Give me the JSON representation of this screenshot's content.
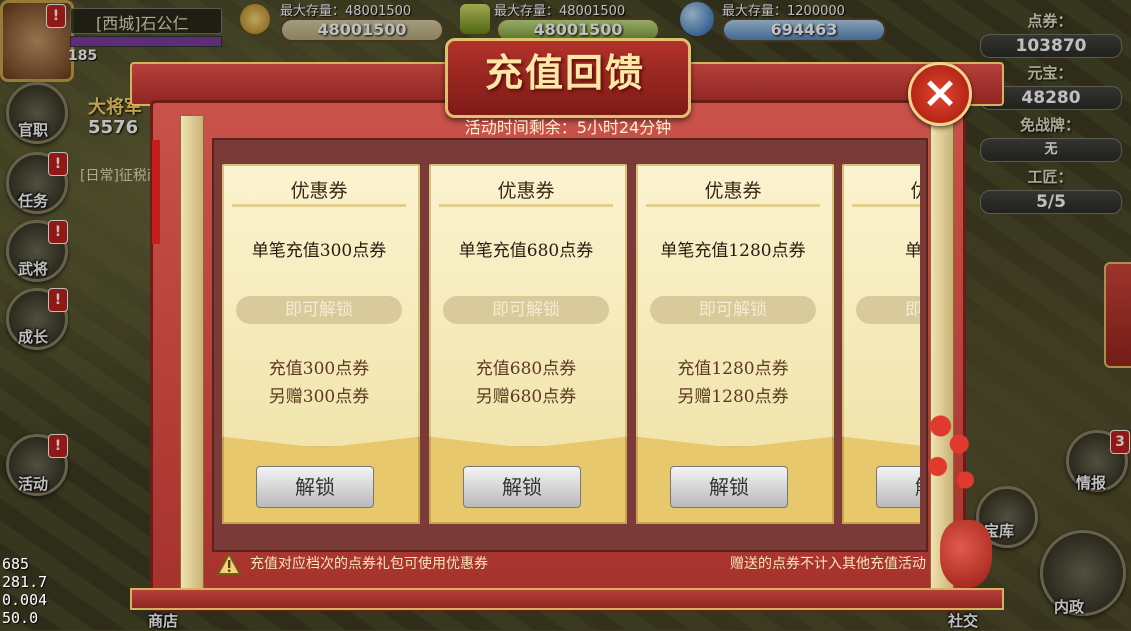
{
  "player": {
    "name": "[西城]石公仁",
    "level": "185",
    "rank_title": "大将军",
    "power": "5576",
    "badge": "!",
    "quest_text": "[日常]征税两"
  },
  "resources": [
    {
      "label": "最大存量：48001500",
      "value": "48001500",
      "icon": "coin-icon"
    },
    {
      "label": "最大存量：48001500",
      "value": "48001500",
      "icon": "grain-icon"
    },
    {
      "label": "最大存量：1200000",
      "value": "694463",
      "icon": "orb-icon"
    }
  ],
  "right_stats": [
    {
      "label": "点券：",
      "value": "103870"
    },
    {
      "label": "元宝：",
      "value": "48280"
    },
    {
      "label": "免战牌：",
      "value": "无"
    },
    {
      "label": "工匠：",
      "value": "5/5"
    }
  ],
  "left_menu": [
    {
      "label": "官职",
      "badge": ""
    },
    {
      "label": "任务",
      "badge": "!"
    },
    {
      "label": "武将",
      "badge": "!"
    },
    {
      "label": "成长",
      "badge": "!"
    },
    {
      "label": "活动",
      "badge": "!"
    }
  ],
  "right_menu": [
    {
      "label": "情报",
      "badge": "3"
    },
    {
      "label": "宝库",
      "badge": ""
    },
    {
      "label": "内政",
      "badge": ""
    }
  ],
  "bottom_menu": [
    {
      "label": "商店"
    },
    {
      "label": "社交"
    }
  ],
  "dialog": {
    "title": "充值回馈",
    "time_remaining": "活动时间剩余：5小时24分钟",
    "close_icon": "close-icon",
    "cards": [
      {
        "title": "优惠券",
        "condition": "单笔充值300点券",
        "unlock_hint": "即可解锁",
        "line1": "充值300点券",
        "line2": "另赠300点券",
        "button": "解锁"
      },
      {
        "title": "优惠券",
        "condition": "单笔充值680点券",
        "unlock_hint": "即可解锁",
        "line1": "充值680点券",
        "line2": "另赠680点券",
        "button": "解锁"
      },
      {
        "title": "优惠券",
        "condition": "单笔充值1280点券",
        "unlock_hint": "即可解锁",
        "line1": "充值1280点券",
        "line2": "另赠1280点券",
        "button": "解锁"
      },
      {
        "title": "优惠券",
        "condition": "单笔充值",
        "unlock_hint": "即可解锁",
        "line1": "充值",
        "line2": "另赠",
        "button": "解锁"
      }
    ],
    "note_left": "充值对应档次的点券礼包可使用优惠券",
    "note_right": "赠送的点券不计入其他充值活动"
  },
  "debug": [
    "685",
    "281.7",
    "0.004",
    "50.0"
  ],
  "colors": {
    "dialog_red": "#a6312c",
    "gold": "#e0bf6e",
    "card_cream": "#fbf3cf",
    "close_red": "#e2462f"
  }
}
